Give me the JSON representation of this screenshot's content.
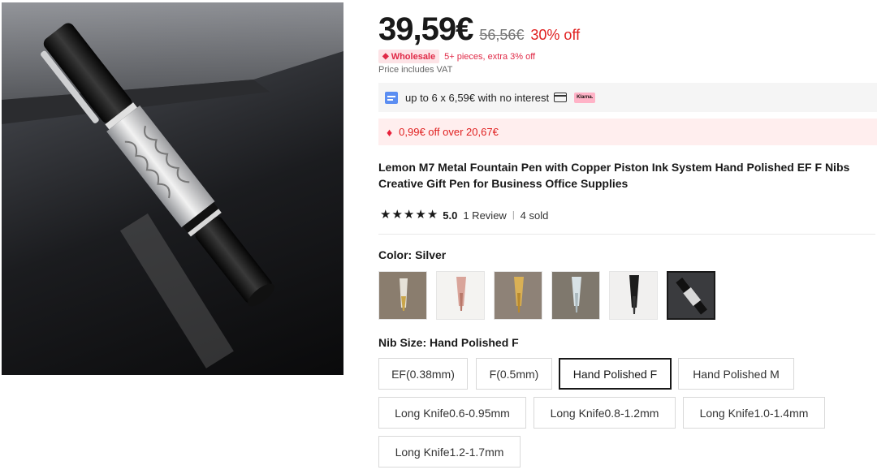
{
  "price": {
    "current": "39,59€",
    "original": "56,56€",
    "discount": "30% off"
  },
  "wholesale": {
    "badge": "Wholesale",
    "info": "5+ pieces, extra 3% off"
  },
  "vat_note": "Price includes VAT",
  "installment": {
    "text": "up to 6 x 6,59€ with no interest",
    "klarna_label": "Klarna."
  },
  "coupon": {
    "text": "0,99€ off over 20,67€"
  },
  "product": {
    "title_line1": "Lemon M7 Metal Fountain Pen with Copper Piston Ink System Hand Polished EF F Nibs",
    "title_line2": "Creative Gift Pen for Business Office Supplies"
  },
  "rating": {
    "score": "5.0",
    "stars": 5,
    "reviews": "1 Review",
    "separator": "|",
    "sold": "4 sold"
  },
  "color": {
    "label": "Color: ",
    "value": "Silver",
    "swatch_count": 6,
    "selected_index": 5
  },
  "nib_size": {
    "label": "Nib Size: ",
    "value": "Hand Polished F",
    "options": [
      "EF(0.38mm)",
      "F(0.5mm)",
      "Hand Polished F",
      "Hand Polished M",
      "Long Knife0.6-0.95mm",
      "Long Knife0.8-1.2mm",
      "Long Knife1.0-1.4mm",
      "Long Knife1.2-1.7mm"
    ],
    "selected": "Hand Polished F"
  },
  "colors": {
    "accent_red": "#e02020",
    "wholesale_pink": "#fde3e6",
    "coupon_bg": "#ffeeee",
    "klarna_pink": "#ffb3c7"
  }
}
